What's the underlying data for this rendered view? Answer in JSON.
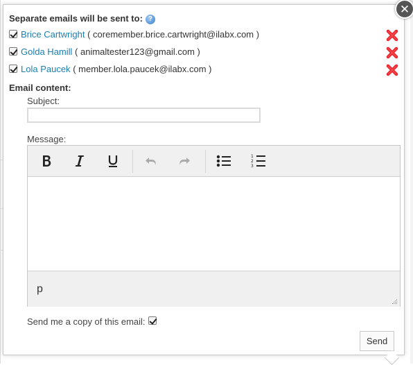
{
  "dialog": {
    "header": "Separate emails will be sent to:",
    "close_label": "✕",
    "help_label": "?",
    "recipients": [
      {
        "name": "Brice Cartwright",
        "email": "( coremember.brice.cartwright@ilabx.com )",
        "checked": true
      },
      {
        "name": "Golda Hamill",
        "email": "( animaltester123@gmail.com )",
        "checked": true
      },
      {
        "name": "Lola Paucek",
        "email": "( member.lola.paucek@ilabx.com )",
        "checked": true
      }
    ],
    "content_label": "Email content:",
    "subject_label": "Subject:",
    "subject_value": "",
    "message_label": "Message:",
    "editor": {
      "toolbar": [
        "bold-icon",
        "italic-icon",
        "underline-icon",
        "undo-icon",
        "redo-icon",
        "bullet-list-icon",
        "numbered-list-icon"
      ],
      "element_path": "p",
      "body_text": ""
    },
    "copy_label": "Send me a copy of this email:",
    "copy_checked": true,
    "send_label": "Send"
  },
  "colors": {
    "link": "#1a7fb3",
    "remove": "#e8232b",
    "toolbar_bg": "#f0f0f0"
  }
}
